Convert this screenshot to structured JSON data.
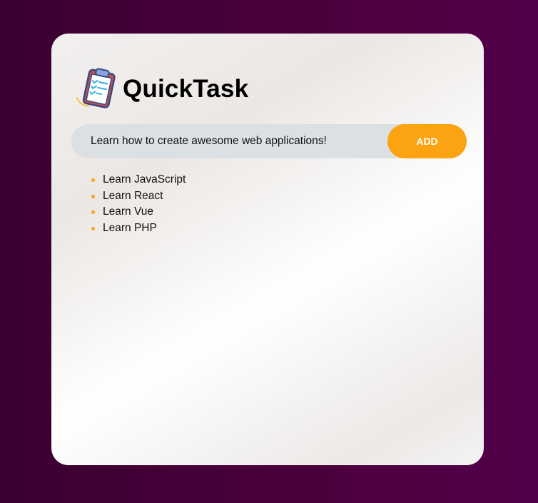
{
  "app": {
    "title": "QuickTask",
    "logo_icon": "clipboard-checklist-icon"
  },
  "task_input": {
    "value": "Learn how to create awesome web applications!"
  },
  "add_button": {
    "label": "ADD"
  },
  "tasks": [
    {
      "label": "Learn JavaScript"
    },
    {
      "label": "Learn React"
    },
    {
      "label": "Learn Vue"
    },
    {
      "label": "Learn PHP"
    }
  ],
  "colors": {
    "accent": "#fca311",
    "background": "#4a003c",
    "input_background": "#dde0e3"
  }
}
